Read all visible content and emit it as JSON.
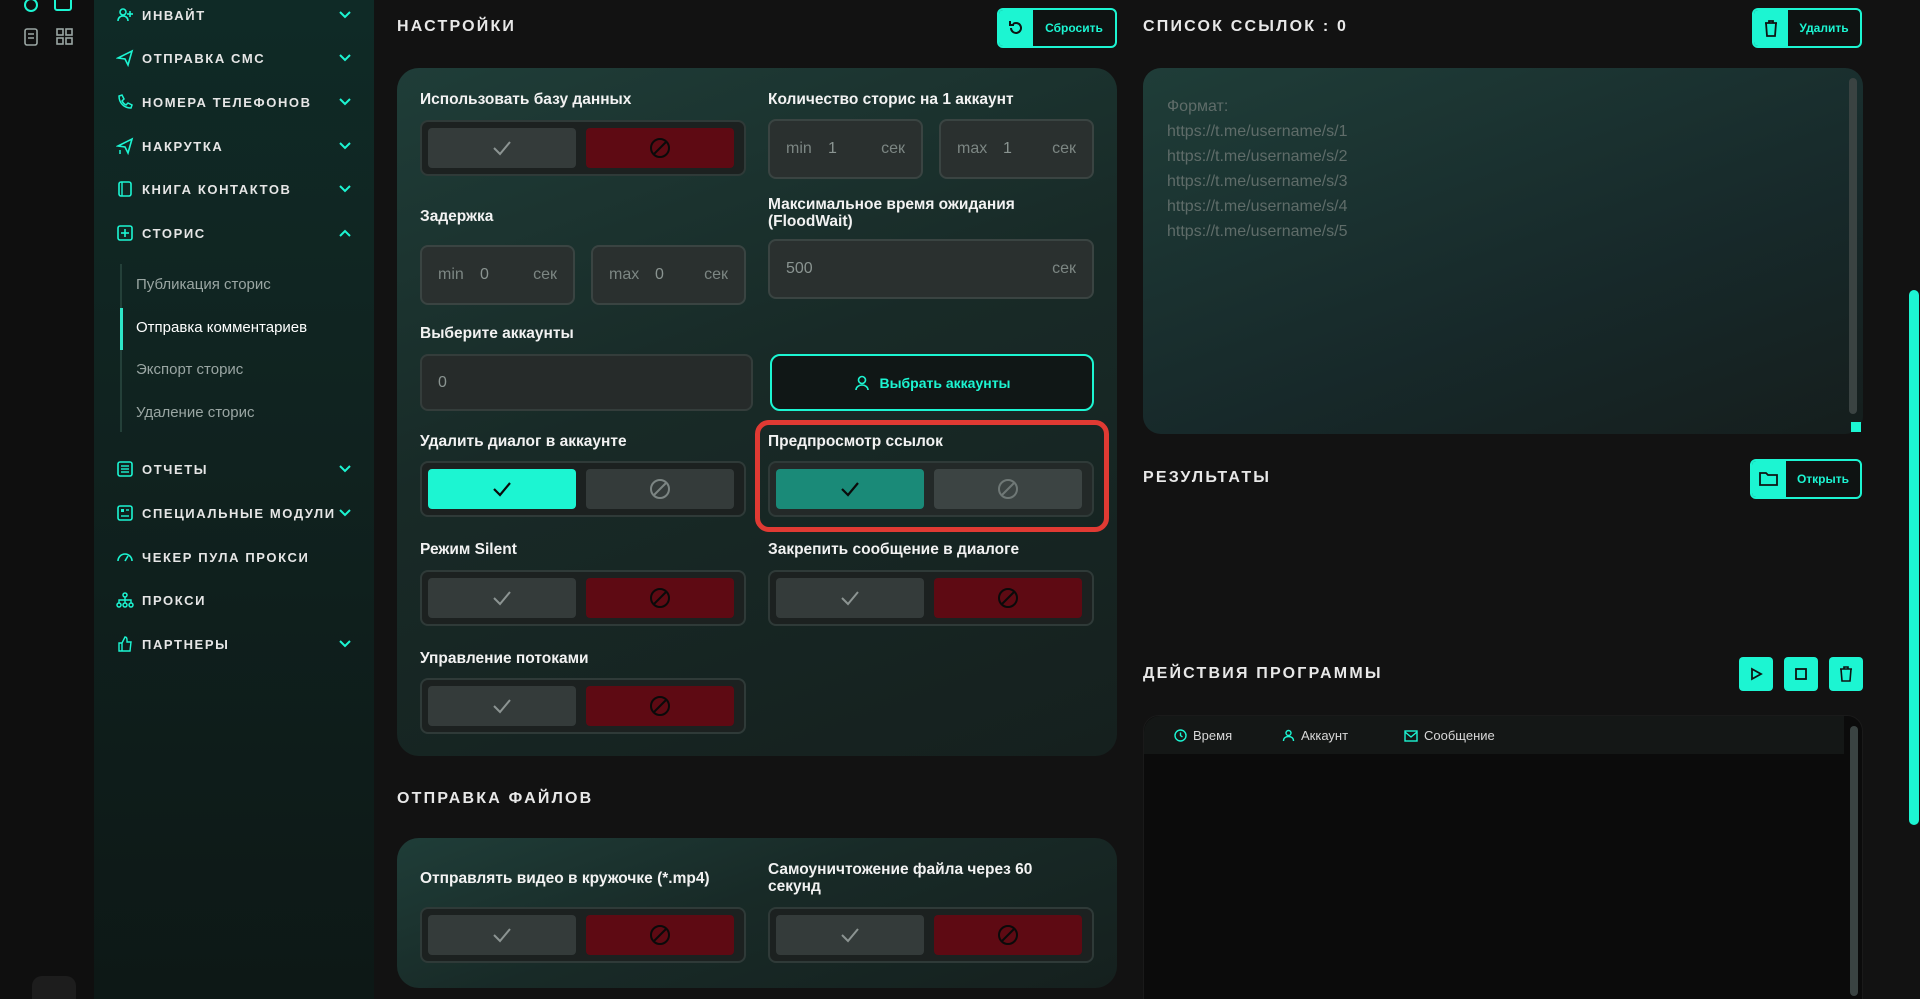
{
  "sidebar": {
    "items": [
      {
        "label": "ИНВАЙТ",
        "icon": "user-plus-icon"
      },
      {
        "label": "ОТПРАВКА СМС",
        "icon": "send-icon"
      },
      {
        "label": "НОМЕРА ТЕЛЕФОНОВ",
        "icon": "phone-icon"
      },
      {
        "label": "НАКРУТКА",
        "icon": "send-plus-icon"
      },
      {
        "label": "КНИГА КОНТАКТОВ",
        "icon": "book-icon"
      },
      {
        "label": "СТОРИС",
        "icon": "plus-square-icon"
      },
      {
        "label": "ОТЧЕТЫ",
        "icon": "report-icon"
      },
      {
        "label": "СПЕЦИАЛЬНЫЕ МОДУЛИ",
        "icon": "modules-icon"
      },
      {
        "label": "ЧЕКЕР ПУЛА ПРОКСИ",
        "icon": "gauge-icon"
      },
      {
        "label": "ПРОКСИ",
        "icon": "network-icon"
      },
      {
        "label": "ПАРТНЕРЫ",
        "icon": "thumbs-up-icon"
      }
    ],
    "stories_sub": [
      "Публикация сторис",
      "Отправка комментариев",
      "Экспорт сторис",
      "Удаление сторис"
    ],
    "active_sub": "Отправка комментариев"
  },
  "settings": {
    "title": "НАСТРОЙКИ",
    "reset_label": "Сбросить",
    "use_db_label": "Использовать базу данных",
    "stories_per_account_label": "Количество сторис на 1 аккаунт",
    "min_prefix": "min",
    "max_prefix": "max",
    "unit": "сек",
    "stories_min": "1",
    "stories_max": "1",
    "delay_label": "Задержка",
    "delay_min": "0",
    "delay_max": "0",
    "floodwait_label_1": "Максимальное время ожидания",
    "floodwait_label_2": "(FloodWait)",
    "floodwait_value": "500",
    "select_accounts_label": "Выберите аккаунты",
    "select_accounts_value": "0",
    "select_accounts_button": "Выбрать аккаунты",
    "delete_dialog_label": "Удалить диалог в аккаунте",
    "link_preview_label": "Предпросмотр ссылок",
    "silent_label": "Режим Silent",
    "pin_label": "Закрепить сообщение в диалоге",
    "threads_label": "Управление потоками"
  },
  "files": {
    "title": "ОТПРАВКА ФАЙЛОВ",
    "video_label": "Отправлять видео в кружочке (*.mp4)",
    "self_destruct_label_1": "Самоуничтожение файла через 60",
    "self_destruct_label_2": "секунд"
  },
  "links": {
    "title": "СПИСОК ССЫЛОК : 0",
    "delete_label": "Удалить",
    "placeholder": "Формат:\nhttps://t.me/username/s/1\nhttps://t.me/username/s/2\nhttps://t.me/username/s/3\nhttps://t.me/username/s/4\nhttps://t.me/username/s/5"
  },
  "results": {
    "title": "РЕЗУЛЬТАТЫ",
    "open_label": "Открыть"
  },
  "actions": {
    "title": "ДЕЙСТВИЯ ПРОГРАММЫ",
    "columns": [
      "Время",
      "Аккаунт",
      "Сообщение"
    ]
  },
  "colors": {
    "accent": "#1cf5d2",
    "danger": "#5e0a13",
    "highlight": "#e03a33"
  }
}
